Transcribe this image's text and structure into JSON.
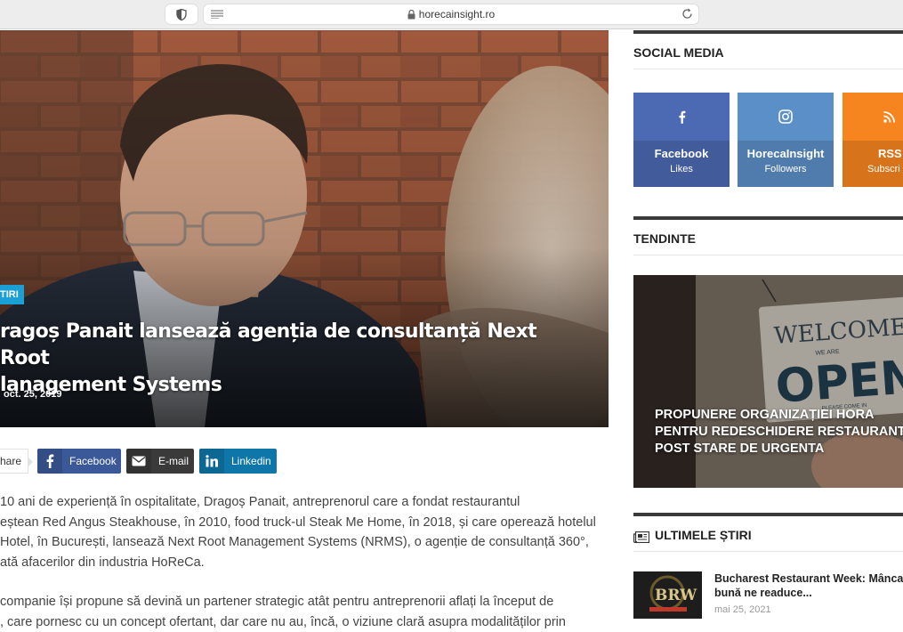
{
  "browser": {
    "url": "horecainsight.ro"
  },
  "hero": {
    "category": "TIRI",
    "title_line1": "ragoș Panait lansează agenția de consultanță Next Root",
    "title_line2": "lanagement Systems",
    "date": "oct. 25, 2019"
  },
  "share": {
    "label": "hare",
    "buttons": [
      {
        "label": "Facebook",
        "icon": "facebook-icon",
        "color": "#3b5998"
      },
      {
        "label": "E-mail",
        "icon": "envelope-icon",
        "color": "#3a3a3a"
      },
      {
        "label": "Linkedin",
        "icon": "linkedin-icon",
        "color": "#0e76a8"
      }
    ]
  },
  "article": {
    "lines": [
      "10 ani de experiență în ospitalitate, Dragoș Panait, antreprenorul care a fondat restaurantul",
      "eștean Red Angus Steakhouse, în 2010, food truck-ul Steak Me Home, în 2018, și care operează hotelul",
      "Hotel, în București, lansează Next Root Management Systems (NRMS), o agenție de consultanță 360°,",
      "ată afacerilor din industria HoReCa."
    ],
    "lines2": [
      "companie își propune să devină un partener strategic atât pentru antreprenorii aflați la început de",
      ", care pornesc cu un concept ofertant, dar care nu au, încă, o viziune clară asupra modalităților prin"
    ]
  },
  "sidebar": {
    "social_heading": "SOCIAL MEDIA",
    "social": [
      {
        "name": "Facebook",
        "sub": "Likes",
        "icon": "facebook-icon",
        "color": "#4c6ab3"
      },
      {
        "name": "HorecaInsight",
        "sub": "Followers",
        "icon": "instagram-icon",
        "color": "#5b8fc7"
      },
      {
        "name": "RSS",
        "sub": "Subscri",
        "icon": "rss-icon",
        "color": "#f7851f"
      }
    ],
    "trends_heading": "TENDINTE",
    "trend_title_lines": [
      "PROPUNERE ORGANIZAȚIEI HORA",
      "PENTRU REDESCHIDERE RESTAURANT",
      "POST STARE DE URGENTA"
    ],
    "sign_text": {
      "welcome": "WELCOME",
      "we_are": "WE ARE",
      "open": "OPEN",
      "come_in": "PLEASE COME IN"
    },
    "latest_heading": "ULTIMELE ȘTIRI",
    "news": [
      {
        "title_line1": "Bucharest Restaurant Week: Mânca",
        "title_line2": "bună ne readuce...",
        "date": "mai 25, 2021",
        "thumb_text": "BRW"
      }
    ]
  }
}
